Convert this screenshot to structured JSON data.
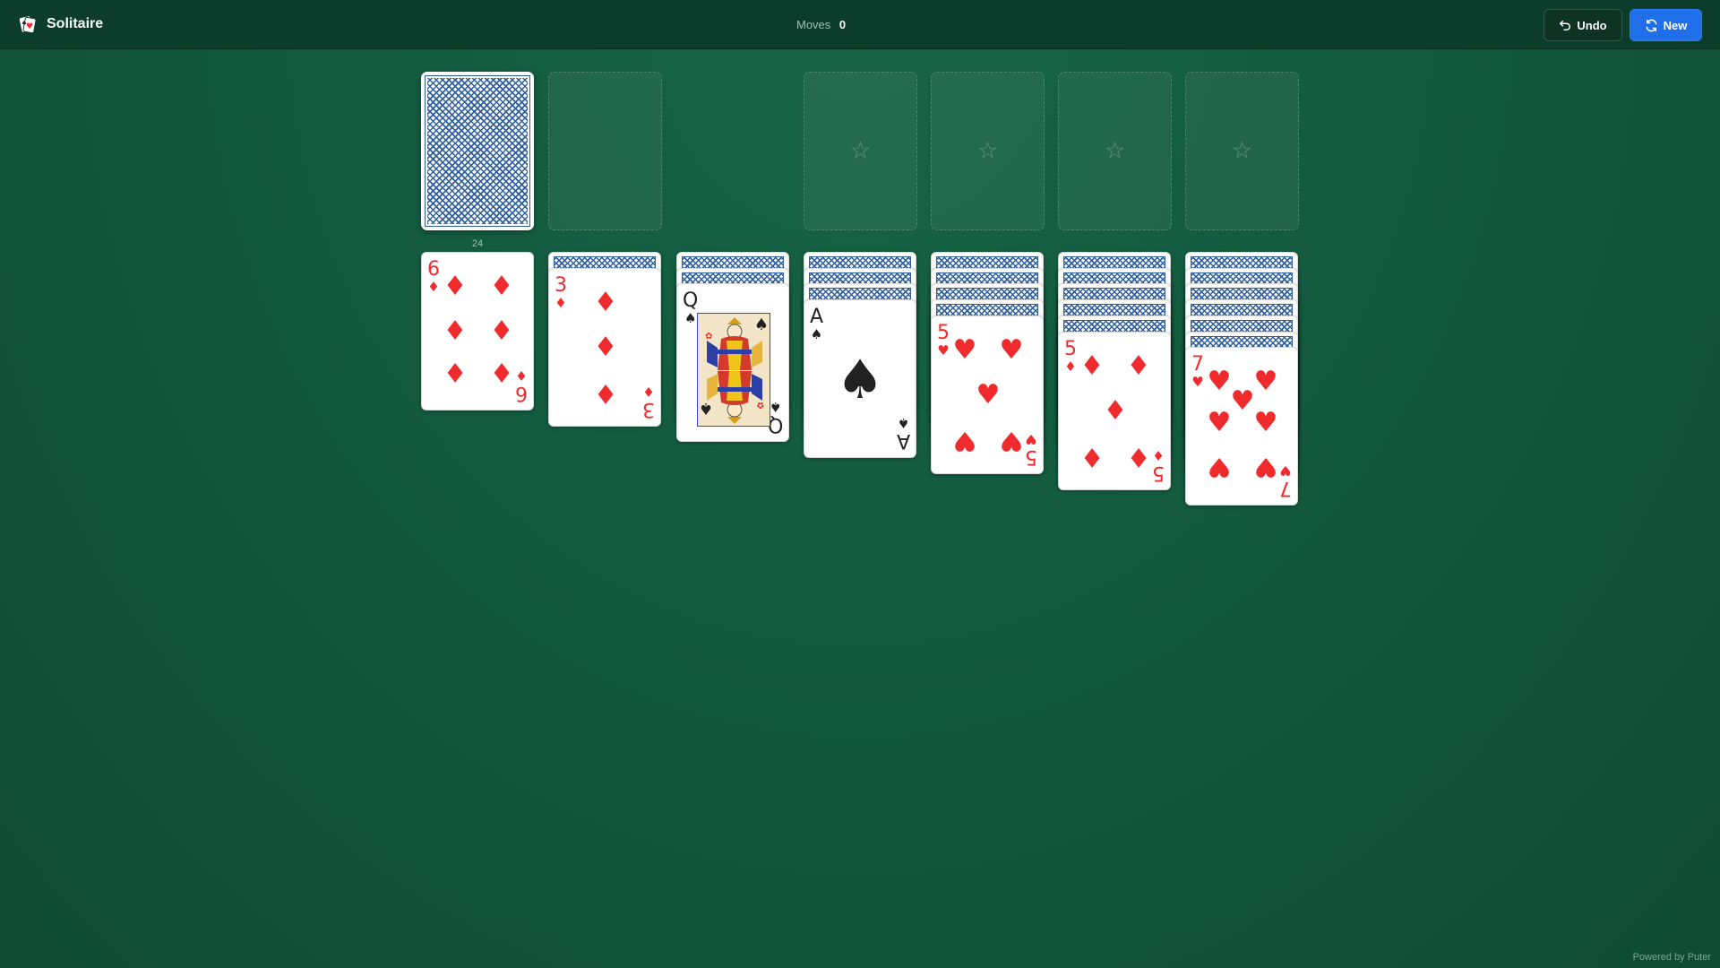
{
  "header": {
    "title": "Solitaire",
    "moves_label": "Moves",
    "moves_value": "0",
    "undo_label": "Undo",
    "new_label": "New"
  },
  "stock": {
    "count": "24"
  },
  "foundation_placeholder": "☆",
  "tableau": [
    {
      "face_down": 0,
      "rank": "6",
      "suit": "♦",
      "color": "red"
    },
    {
      "face_down": 1,
      "rank": "3",
      "suit": "♦",
      "color": "red"
    },
    {
      "face_down": 2,
      "rank": "Q",
      "suit": "♠",
      "color": "black"
    },
    {
      "face_down": 3,
      "rank": "A",
      "suit": "♠",
      "color": "black"
    },
    {
      "face_down": 4,
      "rank": "5",
      "suit": "♥",
      "color": "red"
    },
    {
      "face_down": 5,
      "rank": "5",
      "suit": "♦",
      "color": "red"
    },
    {
      "face_down": 6,
      "rank": "7",
      "suit": "♥",
      "color": "red"
    }
  ],
  "footer": {
    "powered_by": "Powered by Puter"
  },
  "colors": {
    "table": "#135a3f",
    "header": "#0c3d2c",
    "accent": "#1f6feb",
    "red_suit": "#ef2b2d",
    "card_back": "#2d5fa0"
  }
}
